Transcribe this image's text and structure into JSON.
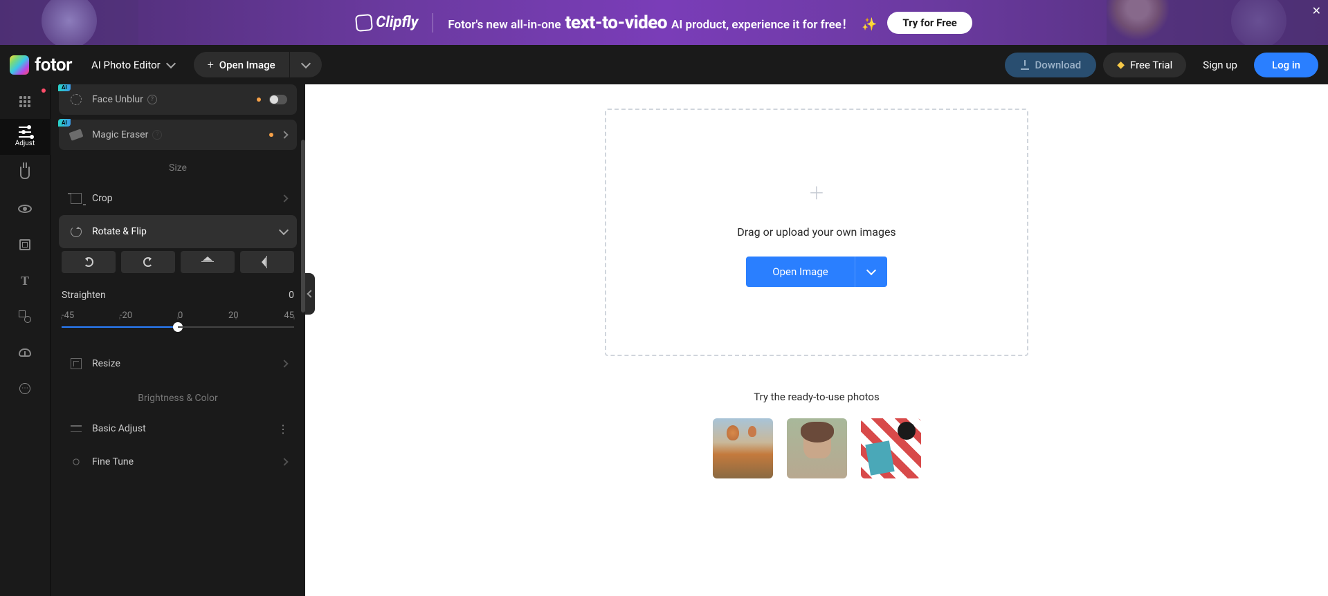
{
  "banner": {
    "brand": "Clipfly",
    "text_before": "Fotor's new all-in-one",
    "highlight": "text-to-video",
    "text_after": "AI product, experience it for free！",
    "sparkle": "✨",
    "cta": "Try for Free"
  },
  "topbar": {
    "logo_text": "fotor",
    "editor_label": "AI Photo Editor",
    "open_image": "Open Image",
    "download": "Download",
    "free_trial": "Free  Trial",
    "signup": "Sign up",
    "login": "Log in"
  },
  "sidebar": {
    "adjust": "Adjust"
  },
  "panel": {
    "ai_badge": "AI",
    "face_unblur": "Face Unblur",
    "magic_eraser": "Magic Eraser",
    "section_size": "Size",
    "crop": "Crop",
    "rotate_flip": "Rotate & Flip",
    "straighten_label": "Straighten",
    "straighten_value": "0",
    "ticks": [
      "-45",
      "-20",
      "0",
      "20",
      "45"
    ],
    "resize": "Resize",
    "section_brightness": "Brightness & Color",
    "basic_adjust": "Basic Adjust",
    "fine_tune": "Fine Tune"
  },
  "canvas": {
    "drop_text": "Drag or upload your own images",
    "open_image": "Open Image",
    "sample_title": "Try the ready-to-use photos"
  }
}
